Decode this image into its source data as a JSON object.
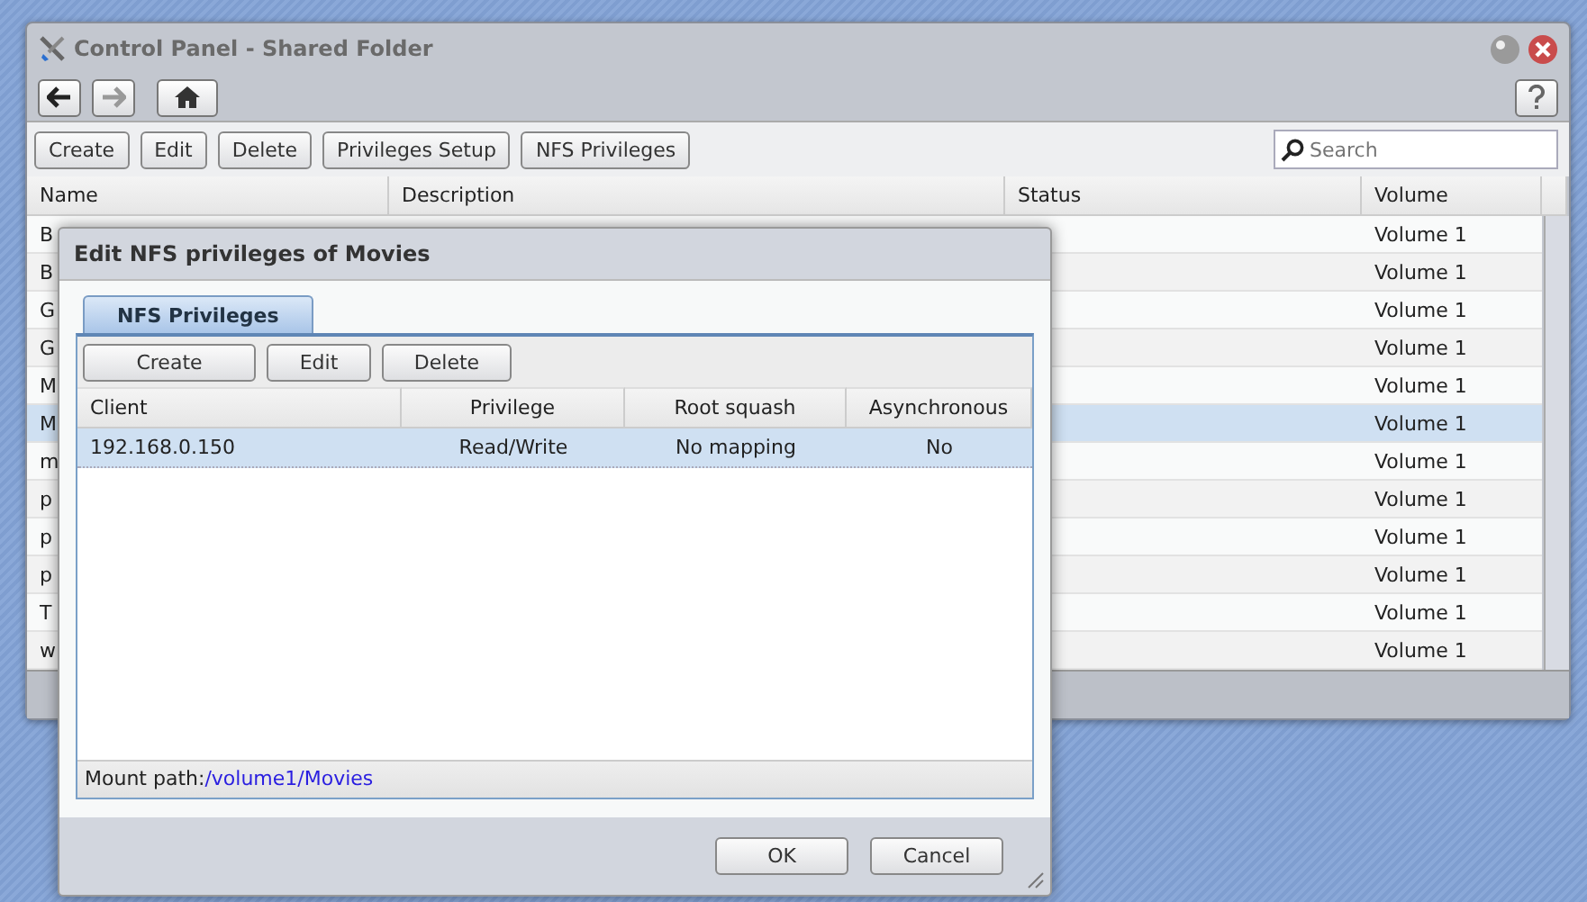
{
  "window": {
    "title": "Control Panel - Shared Folder"
  },
  "toolbar": [
    "Create",
    "Edit",
    "Delete",
    "Privileges Setup",
    "NFS Privileges"
  ],
  "search": {
    "placeholder": "Search"
  },
  "table": {
    "columns": [
      "Name",
      "Description",
      "Status",
      "Volume"
    ],
    "rows": [
      {
        "name": "B",
        "volume": "Volume 1",
        "selected": false
      },
      {
        "name": "B",
        "volume": "Volume 1",
        "selected": false
      },
      {
        "name": "G",
        "volume": "Volume 1",
        "selected": false
      },
      {
        "name": "G",
        "volume": "Volume 1",
        "selected": false
      },
      {
        "name": "M",
        "volume": "Volume 1",
        "selected": false
      },
      {
        "name": "M",
        "volume": "Volume 1",
        "selected": true
      },
      {
        "name": "m",
        "volume": "Volume 1",
        "selected": false
      },
      {
        "name": "p",
        "volume": "Volume 1",
        "selected": false
      },
      {
        "name": "p",
        "volume": "Volume 1",
        "selected": false
      },
      {
        "name": "p",
        "volume": "Volume 1",
        "selected": false
      },
      {
        "name": "T",
        "volume": "Volume 1",
        "selected": false
      },
      {
        "name": "w",
        "volume": "Volume 1",
        "selected": false
      }
    ]
  },
  "dialog": {
    "title": "Edit NFS privileges of Movies",
    "tabs": [
      {
        "label": "NFS Privileges",
        "selected": true
      }
    ],
    "toolbar": [
      "Create",
      "Edit",
      "Delete"
    ],
    "columns": [
      "Client",
      "Privilege",
      "Root squash",
      "Asynchronous"
    ],
    "rows": [
      {
        "cells": [
          "192.168.0.150",
          "Read/Write",
          "No mapping",
          "No"
        ],
        "selected": true
      }
    ],
    "mount_label": "Mount path:",
    "mount_path": "/volume1/Movies",
    "buttons": [
      "OK",
      "Cancel"
    ]
  }
}
